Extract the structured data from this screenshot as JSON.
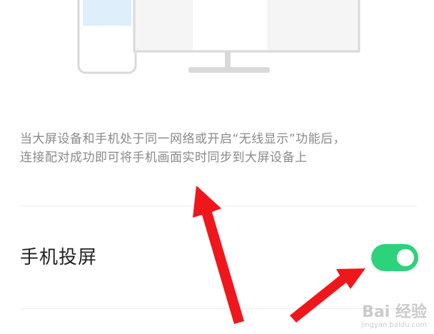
{
  "description": {
    "line1": "当大屏设备和手机处于同一网络或开启“无线显示”功能后，",
    "line2": "连接配对成功即可将手机画面实时同步到大屏设备上"
  },
  "setting": {
    "label": "手机投屏",
    "enabled": true
  },
  "watermark": {
    "brand": "Bai 经验",
    "url": "jingyan.baidu.com"
  },
  "colors": {
    "toggle_on": "#2fd27c",
    "arrow": "#f0171c",
    "description_text": "#8a8a8a"
  }
}
